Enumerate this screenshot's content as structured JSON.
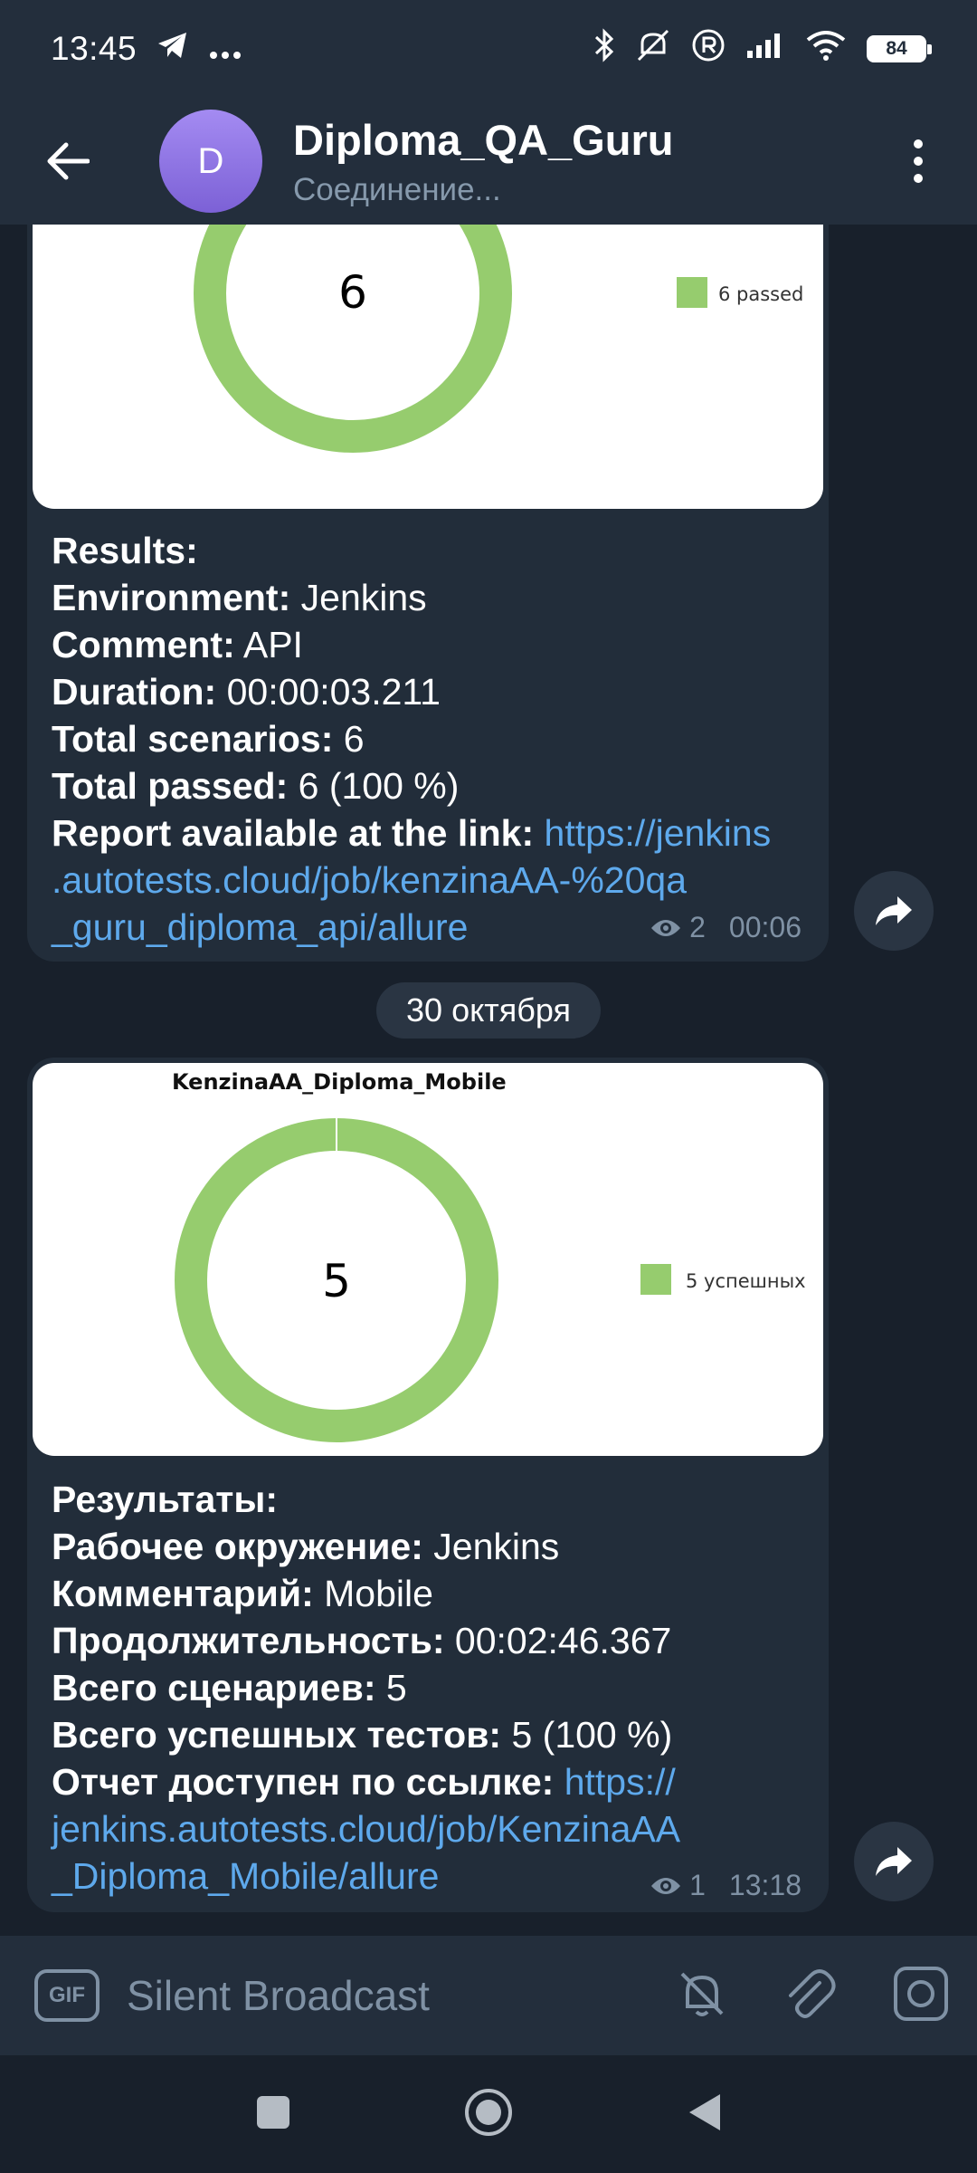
{
  "status_bar": {
    "time": "13:45",
    "battery": "84"
  },
  "header": {
    "avatar_letter": "D",
    "title": "Diploma_QA_Guru",
    "subtitle": "Соединение..."
  },
  "messages": [
    {
      "chart": {
        "center_value": "6",
        "legend": "6 passed",
        "color": "#96cc6e"
      },
      "lines": [
        {
          "label": "Results:",
          "value": ""
        },
        {
          "label": "Environment:",
          "value": " Jenkins"
        },
        {
          "label": "Comment:",
          "value": " API"
        },
        {
          "label": "Duration:",
          "value": " 00:00:03.211"
        },
        {
          "label": "Total scenarios:",
          "value": " 6"
        },
        {
          "label": "Total passed:",
          "value": " 6 (100 %)"
        }
      ],
      "link_label": "Report available at the link:",
      "link_lines": [
        " https://jenkins",
        ".autotests.cloud/job/kenzinaAA-%20qa",
        "_guru_diploma_api/allure"
      ],
      "views": "2",
      "time": "00:06"
    },
    {
      "chart": {
        "title": "KenzinaAA_Diploma_Mobile",
        "center_value": "5",
        "legend": "5 успешных",
        "color": "#96cc6e"
      },
      "lines": [
        {
          "label": "Результаты:",
          "value": ""
        },
        {
          "label": "Рабочее окружение:",
          "value": " Jenkins"
        },
        {
          "label": "Комментарий:",
          "value": " Mobile"
        },
        {
          "label": "Продолжительность:",
          "value": " 00:02:46.367"
        },
        {
          "label": "Всего сценариев:",
          "value": " 5"
        },
        {
          "label": "Всего успешных тестов:",
          "value": " 5 (100 %)"
        }
      ],
      "link_label": "Отчет доступен по ссылке:",
      "link_lines": [
        " https://",
        "jenkins.autotests.cloud/job/KenzinaAA",
        "_Diploma_Mobile/allure"
      ],
      "views": "1",
      "time": "13:18"
    }
  ],
  "date_separator": "30 октября",
  "input": {
    "gif_label": "GIF",
    "placeholder": "Silent Broadcast"
  },
  "colors": {
    "accent_link": "#5ea9ec",
    "bubble": "#222d3a",
    "bar": "#232e3c"
  }
}
